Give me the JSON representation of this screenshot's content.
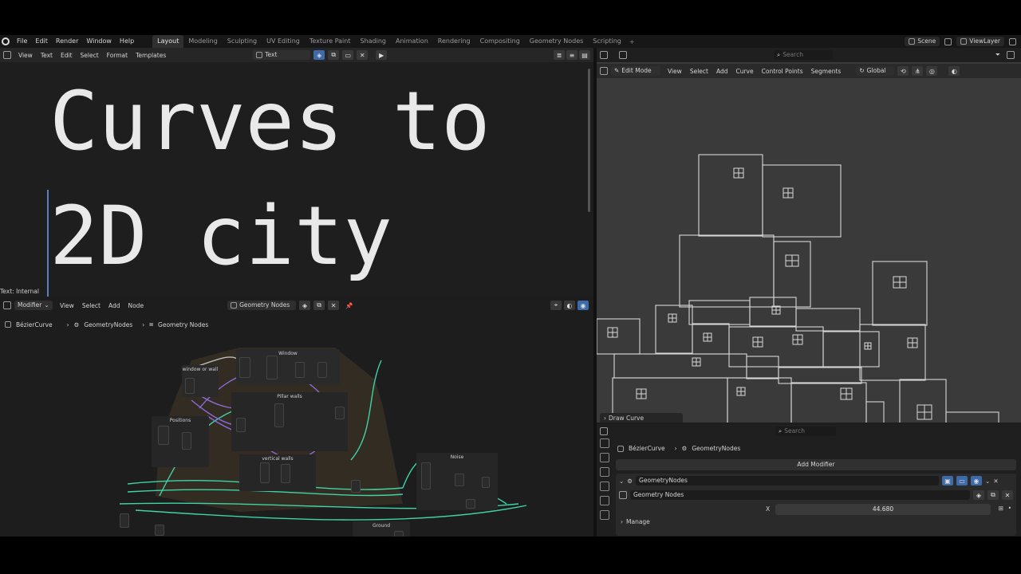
{
  "topbar": {
    "menus": [
      "File",
      "Edit",
      "Render",
      "Window",
      "Help"
    ],
    "workspaces": [
      "Layout",
      "Modeling",
      "Sculpting",
      "UV Editing",
      "Texture Paint",
      "Shading",
      "Animation",
      "Rendering",
      "Compositing",
      "Geometry Nodes",
      "Scripting"
    ],
    "active_workspace": "Layout",
    "scene": "Scene",
    "view_layer": "ViewLayer"
  },
  "text_editor": {
    "menus": [
      "View",
      "Text",
      "Edit",
      "Select",
      "Format",
      "Templates"
    ],
    "datablock": "Text",
    "line1": "Curves to",
    "line2": "2D city",
    "status": "Text: Internal"
  },
  "node_editor": {
    "editor_type": "Modifier",
    "menus": [
      "View",
      "Select",
      "Add",
      "Node"
    ],
    "node_group": "Geometry Nodes",
    "breadcrumb": [
      "BézierCurve",
      "GeometryNodes",
      "Geometry Nodes"
    ],
    "frames": [
      "Window",
      "window or wall",
      "Positions",
      "Pillar walls",
      "vertical walls",
      "Noise",
      "Ground"
    ]
  },
  "viewport": {
    "search_placeholder": "Search",
    "mode": "Edit Mode",
    "menus": [
      "View",
      "Select",
      "Add",
      "Curve",
      "Control Points",
      "Segments"
    ],
    "orientation": "Global",
    "operator_panel": "Draw Curve"
  },
  "properties": {
    "search_placeholder": "Search",
    "breadcrumb": [
      "BézierCurve",
      "GeometryNodes"
    ],
    "add_modifier": "Add Modifier",
    "modifier_name": "GeometryNodes",
    "node_group": "Geometry Nodes",
    "x_label": "X",
    "x_value": "44.680",
    "manage": "Manage"
  },
  "colors": {
    "accent_blue": "#3d6aa8",
    "wire_green": "#3fd3a6",
    "wire_purple": "#8a6ad8",
    "frame_brown": "#4a3d2c"
  }
}
